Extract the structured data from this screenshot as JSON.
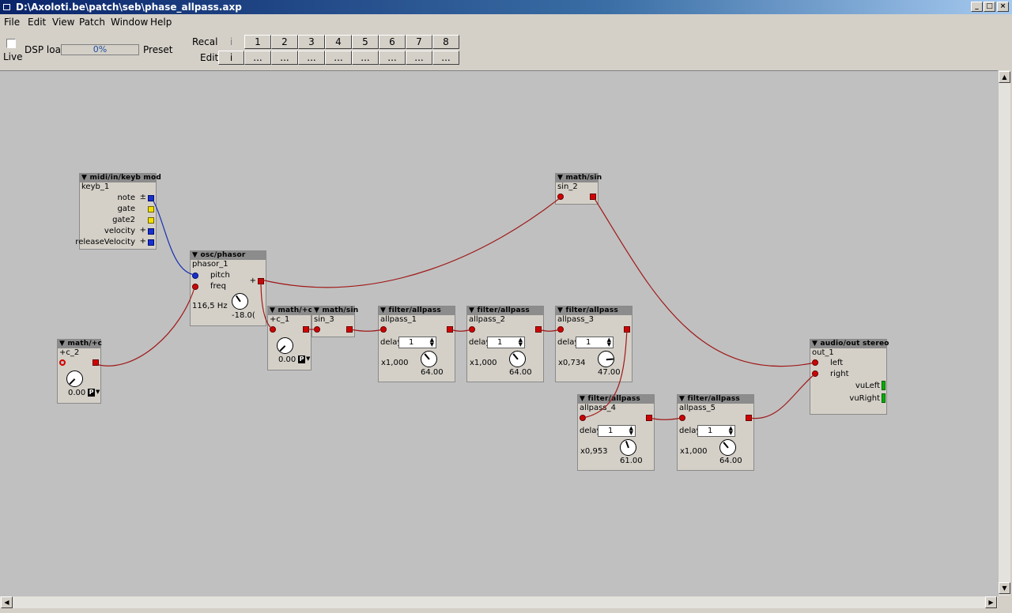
{
  "window": {
    "title": "D:\\Axoloti.be\\patch\\seb\\phase_allpass.axp",
    "buttons": [
      "_",
      "□",
      "×"
    ]
  },
  "menu": [
    "File",
    "Edit",
    "View",
    "Patch",
    "Window",
    "Help"
  ],
  "toolbar": {
    "live_label": "Live",
    "dsp_label": "DSP load",
    "dsp_value": "0%",
    "preset_label": "Preset",
    "recall_label": "Recall",
    "edit_label": "Edit",
    "recall_i": "i",
    "edit_i": "i",
    "preset_numbers": [
      "1",
      "2",
      "3",
      "4",
      "5",
      "6",
      "7",
      "8"
    ],
    "edit_buttons": [
      "...",
      "...",
      "...",
      "...",
      "...",
      "...",
      "...",
      "..."
    ]
  },
  "objects": {
    "keyb": {
      "type": "▼ midi/in/keyb mod",
      "name": "keyb_1",
      "outputs": [
        "note",
        "gate",
        "gate2",
        "velocity",
        "releaseVelocity"
      ],
      "signs": [
        "±",
        "+"
      ]
    },
    "phasor": {
      "type": "▼ osc/phasor",
      "name": "phasor_1",
      "inputs": [
        "pitch",
        "freq"
      ],
      "out_sign": "+",
      "freq_display": "116,5 Hz",
      "knob_value": "-18.0("
    },
    "sin2": {
      "type": "▼ math/sin",
      "name": "sin_2"
    },
    "sin3": {
      "type": "▼ math/sin",
      "name": "sin_3"
    },
    "c1": {
      "type": "▼ math/+c",
      "name": "+c_1",
      "value": "0.00",
      "p": "P"
    },
    "c2": {
      "type": "▼ math/+c",
      "name": "+c_2",
      "value": "0.00",
      "p": "P"
    },
    "ap1": {
      "type": "▼ filter/allpass",
      "name": "allpass_1",
      "delay_label": "delay",
      "delay": "1",
      "mult": "x1,000",
      "value": "64.00"
    },
    "ap2": {
      "type": "▼ filter/allpass",
      "name": "allpass_2",
      "delay_label": "delay",
      "delay": "1",
      "mult": "x1,000",
      "value": "64.00"
    },
    "ap3": {
      "type": "▼ filter/allpass",
      "name": "allpass_3",
      "delay_label": "delay",
      "delay": "1",
      "mult": "x0,734",
      "value": "47.00"
    },
    "ap4": {
      "type": "▼ filter/allpass",
      "name": "allpass_4",
      "delay_label": "delay",
      "delay": "1",
      "mult": "x0,953",
      "value": "61.00"
    },
    "ap5": {
      "type": "▼ filter/allpass",
      "name": "allpass_5",
      "delay_label": "delay",
      "delay": "1",
      "mult": "x1,000",
      "value": "64.00"
    },
    "out": {
      "type": "▼ audio/out stereo",
      "name": "out_1",
      "inputs": [
        "left",
        "right"
      ],
      "meters": [
        "vuLeft",
        "vuRight"
      ]
    }
  },
  "colors": {
    "wire_audio": "#a01818",
    "wire_pitch": "#1830b0",
    "canvas": "#c0c0c0"
  }
}
